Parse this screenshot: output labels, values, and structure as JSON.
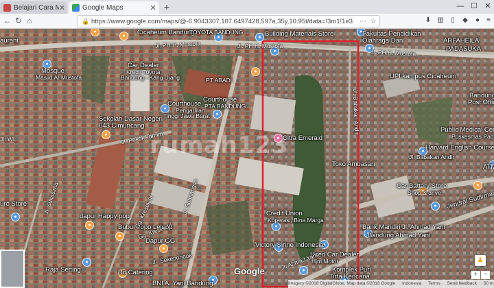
{
  "browser": {
    "tabs": [
      {
        "label": "Belajari Cara Membuat Iklan Ju",
        "icon": "page-icon",
        "active": false
      },
      {
        "label": "Google Maps",
        "icon": "google-maps-icon",
        "active": true
      }
    ],
    "new_tab_label": "+",
    "url": "https://www.google.com/maps/@-6.9043307,107.6497428,597a,35y,10.95t/data=!3m1!1e3"
  },
  "map": {
    "labels": {
      "cicaheum_bandung": "Cicaheum Bandung",
      "toyota_bandung": "TOYOTA BANDUNG",
      "building_materials": "Building Materials Store",
      "fakultas": "Fakultas Pendidikan",
      "olahraga": "Olahraga Dan",
      "arfaheila": "ARFAHEILA",
      "padasuka": "PADASUKA",
      "restaurant": "aurant",
      "mosque": "Mosque",
      "masjid": "Masjid Al-Mustofa",
      "car_dealer": "Car Dealer",
      "kredit_toyota": "Kredit Toyota",
      "bandung_kang": "Bandung - Kang Ujang",
      "pt_abadi": "PT ABADI",
      "courthouse_right": "Courthouse",
      "pta_bandung": "PTA BANDUNG",
      "upi_kampus": "UPI kampus Cicaheum",
      "sekolah": "Sekolah Dasar Negeri",
      "cimuncang": "043 Cimuncang",
      "courthouse": "Courthouse",
      "pengadilan": "Pengadilan",
      "tinggi_jawa": "Tinggi Jawa Barat",
      "postal": "Bandung",
      "post_office": "Post Office",
      "public_medical": "Public Medical Center",
      "puskesmas": "Puskesmas Padasuka",
      "citra_emerald": "Citra Emerald",
      "harvard": "Harvard English Course",
      "babakan_andir": "Jl. Babakan Andir",
      "toko_ambasari": "Toko Ambasari",
      "atm": "ATM",
      "car_battery": "Car Battery Store",
      "shop_drive": "Shop & drive",
      "jendral": "Jendral Sudirman",
      "credit_union": "Credit Union",
      "koperasi": "Koperasi, Bina Marga",
      "ure_store": "ure Store",
      "dapur_happy": "dapur Happy pop",
      "bubur_topo": "Bubur Topo Leloop",
      "dapur_gg": "Dapur GG",
      "bank_mandiri": "Bank Mandiri Jl. Ahmad Yani",
      "bandung_ahmad": "Bandung Ahmad Yani",
      "victory_sirine": "Victory Sirine Indonesia",
      "used_car": "Used Car Dealer",
      "hjm_motor": "Hjm Motor",
      "komplek_puri": "Komplek Puri",
      "tirta_kencana": "Tirta Kencana",
      "raja_setting": "Raja Setting",
      "rd_catering": "Rd Catering",
      "bni": "BNI A. Yani Bandung",
      "sekepondok": "Jl. Sekepondok"
    },
    "roads": {
      "ph_mustofa_left": "Jl. PH.H. Mustofa",
      "ph_mustofa_mid": "Jl. PH H. Mustofa",
      "ph_mustofa_right": "Jl. PH.H. Mustofa",
      "pakak_tamim": "Jl. Pokok Tamim",
      "jl_sukasirna": "Jl. Sukasirna",
      "jl_sutmangsa": "Jl. Sutmangsa",
      "gg_kresek": "Gg. Kresek III",
      "gg_kresek2": "Gg. Kresek III",
      "ahmad_yani": "Jl. Ahmad Yani",
      "jl_babakan": "Jl. Babakan Andir",
      "jl_wl": "Jl. WL"
    },
    "watermark": "rumah123",
    "google_logo": "Google",
    "attribution": [
      "Imagery ©2018 DigitalGlobe, Map data ©2018 Google",
      "Indonesia",
      "Terms",
      "Send feedback",
      "50 m"
    ],
    "highlight_color": "#e0202a"
  }
}
